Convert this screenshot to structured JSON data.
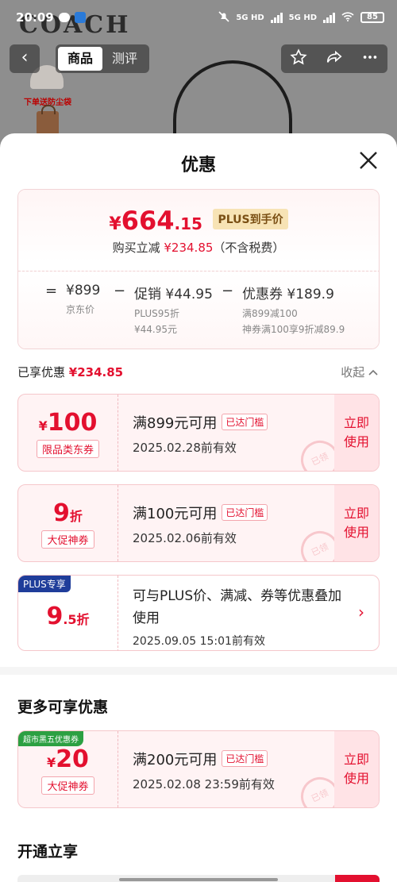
{
  "status_bar": {
    "time": "20:09",
    "signal_1": "5G HD",
    "signal_2": "5G HD",
    "battery": "85"
  },
  "product_page": {
    "brand": "COACH",
    "promo_tag": "下单送防尘袋",
    "tabs": [
      "商品",
      "测评"
    ],
    "active_tab": "商品"
  },
  "sheet": {
    "title": "优惠",
    "summary": {
      "yen": "¥",
      "price_int": "664",
      "price_dec": ".15",
      "plus_label": "PLUS到手价",
      "save_prefix": "购买立减",
      "save_amount": "¥234.85",
      "save_suffix": "（不含税费）",
      "breakdown": {
        "equals": "=",
        "jd_price": "¥899",
        "jd_price_label": "京东价",
        "minus1": "−",
        "promo": "促销 ¥44.95",
        "promo_detail_1": "PLUS95折",
        "promo_detail_2": "¥44.95元",
        "minus2": "−",
        "coupon": "优惠券 ¥189.9",
        "coupon_detail_1": "满899减100",
        "coupon_detail_2": "神券满100享9折减89.9"
      }
    },
    "enjoyed": {
      "label": "已享优惠",
      "amount": "¥234.85",
      "collapse_label": "收起"
    },
    "coupons": [
      {
        "yen": "¥",
        "amount": "100",
        "unit": "",
        "type": "限品类东券",
        "condition": "满899元可用",
        "threshold_tag": "已达门槛",
        "valid": "2025.02.28前有效",
        "action": "立即使用",
        "stamp": "已领"
      },
      {
        "yen": "",
        "amount": "9",
        "unit": "折",
        "type": "大促神券",
        "condition": "满100元可用",
        "threshold_tag": "已达门槛",
        "valid": "2025.02.06前有效",
        "action": "立即使用",
        "stamp": "已领"
      }
    ],
    "plus_coupon": {
      "badge": "PLUS专享",
      "amount": "9",
      "decimal": ".5",
      "unit": "折",
      "description": "可与PLUS价、满减、券等优惠叠加使用",
      "valid": "2025.09.05 15:01前有效",
      "arrow": "›"
    },
    "more_section": {
      "title": "更多可享优惠",
      "coupon": {
        "badge": "超市黑五优惠券",
        "yen": "¥",
        "amount": "20",
        "type": "大促神券",
        "condition": "满200元可用",
        "threshold_tag": "已达门槛",
        "valid": "2025.02.08 23:59前有效",
        "action": "立即使用",
        "stamp": "已领"
      }
    },
    "open_section": {
      "title": "开通立享"
    }
  },
  "colors": {
    "accent_red": "#e3102f",
    "plus_gold_bg": "#f7e3b5",
    "plus_blue": "#1f3d9a",
    "badge_green": "#2ca042"
  }
}
